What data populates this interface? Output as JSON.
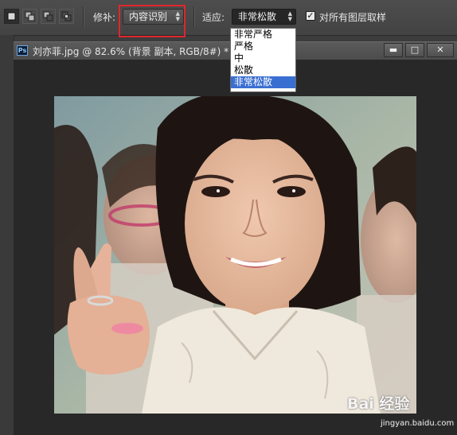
{
  "toolbar": {
    "patch_label": "修补:",
    "patch_value": "内容识别",
    "adapt_label": "适应:",
    "adapt_value": "非常松散",
    "sample_all_layers_label": "对所有图层取样",
    "sample_all_layers_checked": true
  },
  "adapt_menu": {
    "options": [
      "非常严格",
      "严格",
      "中",
      "松散",
      "非常松散"
    ],
    "selected": "非常松散"
  },
  "document": {
    "title": "刘亦菲.jpg @ 82.6% (背景 副本, RGB/8#) *",
    "icon": "Ps"
  },
  "watermark": {
    "brand": "Bai 经验",
    "url": "jingyan.baidu.com"
  },
  "colors": {
    "highlight_box": "#e0262c",
    "menu_selection": "#3a6fd2"
  }
}
